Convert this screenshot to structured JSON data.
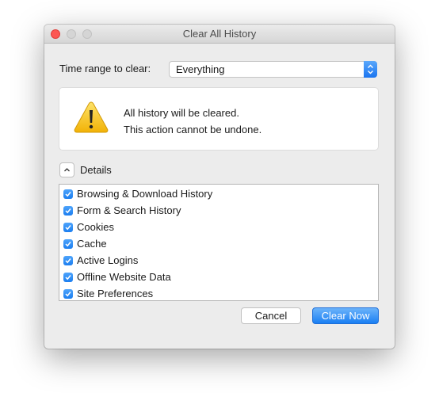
{
  "window": {
    "title": "Clear All History",
    "traffic_lights": [
      "close",
      "minimize",
      "zoom"
    ]
  },
  "time_range": {
    "label": "Time range to clear:",
    "selected": "Everything",
    "arrow_icon": "updown-chevron-icon"
  },
  "warning": {
    "icon": "warning-triangle-icon",
    "line1": "All history will be cleared.",
    "line2": "This action cannot be undone."
  },
  "details": {
    "toggle_icon": "chevron-up-icon",
    "label": "Details",
    "items": [
      {
        "label": "Browsing & Download History",
        "checked": true
      },
      {
        "label": "Form & Search History",
        "checked": true
      },
      {
        "label": "Cookies",
        "checked": true
      },
      {
        "label": "Cache",
        "checked": true
      },
      {
        "label": "Active Logins",
        "checked": true
      },
      {
        "label": "Offline Website Data",
        "checked": true
      },
      {
        "label": "Site Preferences",
        "checked": true
      }
    ]
  },
  "buttons": {
    "cancel": "Cancel",
    "clear_now": "Clear Now"
  },
  "colors": {
    "accent": "#1a7ff3",
    "close_light": "#fc5753",
    "warning_yellow": "#f7c21b"
  }
}
